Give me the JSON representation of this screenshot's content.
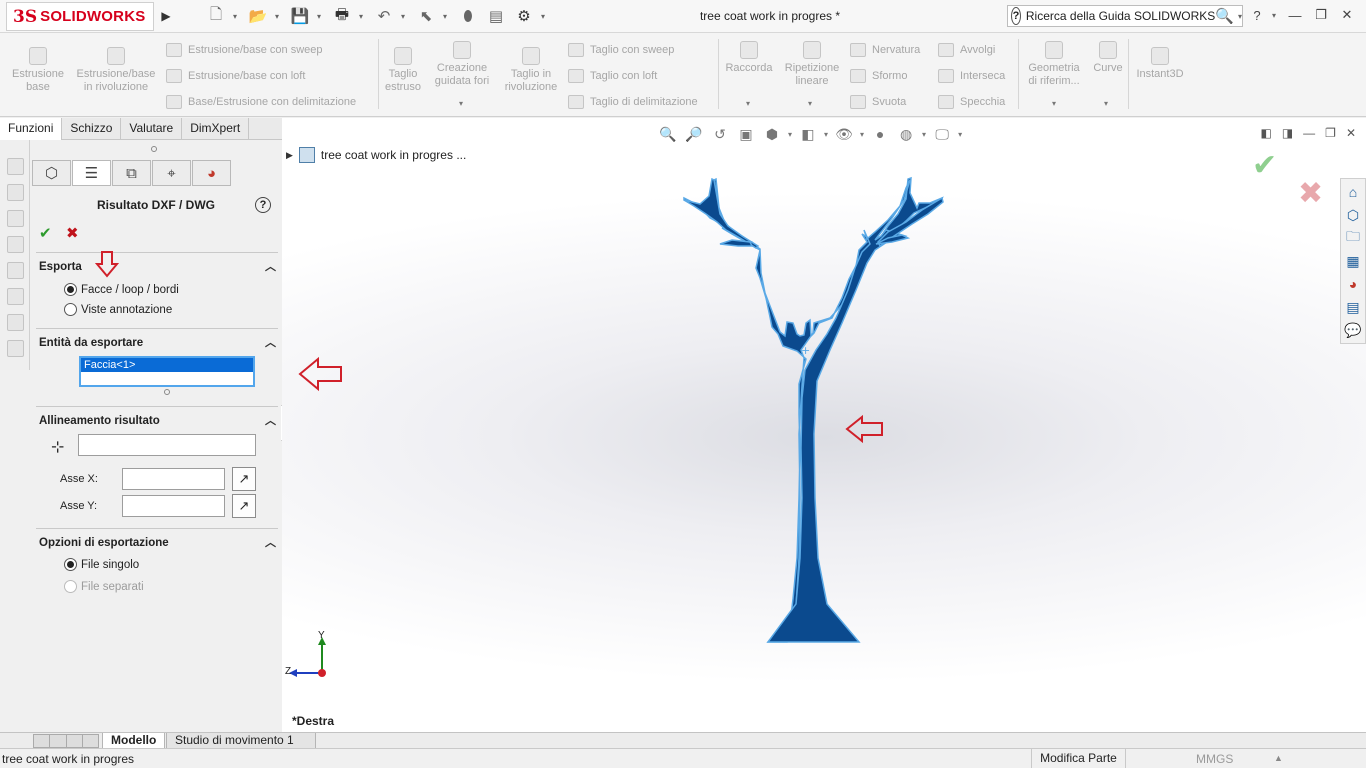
{
  "app": {
    "logo_mark": "3S",
    "logo_text": "SOLIDWORKS",
    "document_title": "tree coat work in progres *",
    "search_placeholder": "Ricerca della Guida SOLIDWORKS",
    "help_label": "?",
    "accent": "#d6001c"
  },
  "ribbon": {
    "estrusione_base": "Estrusione base",
    "estrusione_rivoluzione": "Estrusione/base in rivoluzione",
    "estrusione_sweep": "Estrusione/base con sweep",
    "estrusione_loft": "Estrusione/base con loft",
    "base_delimitazione": "Base/Estrusione con delimitazione",
    "taglio_estruso": "Taglio estruso",
    "creazione_fori": "Creazione guidata fori",
    "taglio_rivoluzione": "Taglio in rivoluzione",
    "taglio_sweep": "Taglio con sweep",
    "taglio_loft": "Taglio con loft",
    "taglio_delimitazione": "Taglio di delimitazione",
    "raccorda": "Raccorda",
    "ripetizione": "Ripetizione lineare",
    "nervatura": "Nervatura",
    "sformo": "Sformo",
    "svuota": "Svuota",
    "avvolgi": "Avvolgi",
    "interseca": "Interseca",
    "specchia": "Specchia",
    "geometria": "Geometria di riferim...",
    "curve": "Curve",
    "instant3d": "Instant3D"
  },
  "tabs": [
    "Funzioni",
    "Schizzo",
    "Valutare",
    "DimXpert"
  ],
  "panel": {
    "title": "Risultato DXF / DWG",
    "esporta": {
      "title": "Esporta",
      "option1": "Facce / loop / bordi",
      "option2": "Viste annotazione"
    },
    "entita": {
      "title": "Entità da esportare",
      "item": "Faccia<1>"
    },
    "allineamento": {
      "title": "Allineamento risultato",
      "asse_x": "Asse X:",
      "asse_y": "Asse Y:"
    },
    "opzioni": {
      "title": "Opzioni di esportazione",
      "option1": "File singolo",
      "option2": "File separati"
    }
  },
  "viewport": {
    "tree_node": "tree coat work in progres  ...",
    "view_name": "*Destra",
    "axis_y": "Y",
    "axis_z": "Z",
    "part_color": "#0b4a8e"
  },
  "bottom_tabs": [
    "Modello",
    "Studio di movimento 1"
  ],
  "status": {
    "left": "tree coat work in progres",
    "mode": "Modifica Parte",
    "units": "MMGS"
  }
}
